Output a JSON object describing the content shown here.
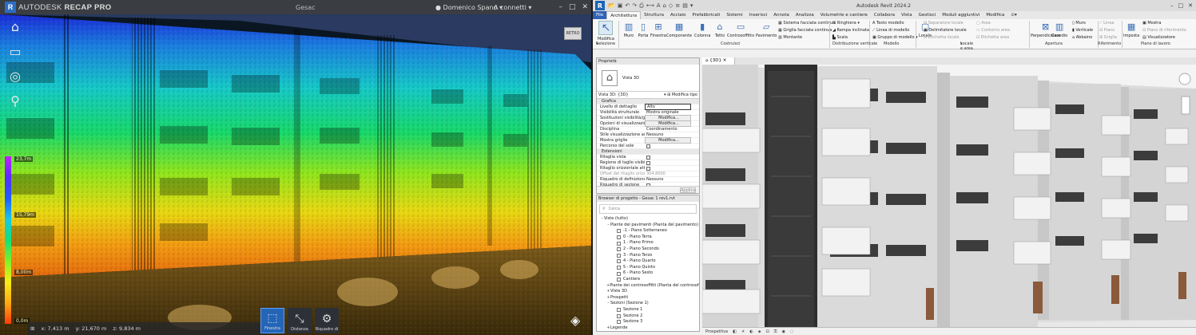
{
  "recap": {
    "logo_letter": "R",
    "brand": "AUTODESK",
    "app": "RECAP PRO",
    "project": "Gesac",
    "user": "Domenico Spano",
    "cloud": "connetti",
    "window": {
      "min": "–",
      "max": "□",
      "close": "✕"
    },
    "legend_labels": [
      "23,7m",
      "15,79m",
      "8,00m",
      "0,0m"
    ],
    "coords": {
      "x": "x: 7,413 m",
      "y": "y: 21,670 m",
      "z": "z: 9,834 m"
    },
    "tools": [
      {
        "label": "Finestra"
      },
      {
        "label": "Distanza"
      },
      {
        "label": "Riquadro di"
      }
    ],
    "view_cube": "RETRO",
    "colors": {
      "bg": "#3a3d42",
      "accent": "#2465b8"
    }
  },
  "revit": {
    "logo_letter": "R",
    "title": "Autodesk Revit 2024.2",
    "window": {
      "min": "–",
      "max": "□",
      "close": "✕"
    },
    "tabs": [
      "File",
      "Architettura",
      "Struttura",
      "Acciaio",
      "Prefabbricati",
      "Sistemi",
      "Inserisci",
      "Annota",
      "Analizza",
      "Volumetrie e cantiere",
      "Collabora",
      "Vista",
      "Gestisci",
      "Moduli aggiuntivi",
      "Modifica"
    ],
    "ribbon_buttons": {
      "modifica": "Modifica",
      "muro": "Muro",
      "porta": "Porta",
      "finestra": "Finestra",
      "componente": "Componente",
      "colonna": "Colonna",
      "tetto": "Tetto",
      "controsoffitto": "Controsoffitto",
      "pavimento": "Pavimento",
      "sistema_facciata": "Sistema facciata continua",
      "griglia_facciata": "Griglia facciata continua",
      "montante": "Montante",
      "ringhiera": "Ringhiera",
      "rampa": "Rampa inclinata",
      "scala": "Scala",
      "testo_modello": "Testo modello",
      "linea_modello": "Linea di modello",
      "gruppo_modello": "Gruppo di modello",
      "locale": "Locale",
      "separatore": "Separatore locale",
      "etichetta_locale": "Etichetta locale",
      "delimitatore": "Delimitatore locale",
      "area": "Area",
      "contorno_area": "Contorno area",
      "etichetta_area": "Etichetta area",
      "perpendicolare": "Perpendicolare",
      "cavedio": "Cavedio",
      "muro2": "Muro",
      "verticale": "Verticale",
      "abbaino": "Abbaino",
      "linea": "Linea",
      "piano": "Piano",
      "griglia": "Griglia",
      "imposta": "Imposta",
      "mostra": "Mostra",
      "piano_riferimento": "Piano di riferimento",
      "visualizzatore": "Visualizzatore"
    },
    "panels": [
      "Selezione",
      "Costruisci",
      "Distribuzione verticale",
      "Modello",
      "Locale e area",
      "Apertura",
      "Riferimento",
      "Piano di lavoro"
    ],
    "properties": {
      "header": "Proprietà",
      "type_name": "Vista 3D",
      "selector": "Vista 3D: {3D}",
      "edit_type": "Modifica tipo",
      "rows": [
        {
          "k": "Grafica",
          "group": true
        },
        {
          "k": "Livello di dettaglio",
          "v": "Alto",
          "kind": "box"
        },
        {
          "k": "Visibilità strutturale",
          "v": "Mostra originale"
        },
        {
          "k": "Sostituzioni visibilità/grafica",
          "v": "Modifica...",
          "kind": "btn"
        },
        {
          "k": "Opzioni di visualizzazione grafica",
          "v": "Modifica...",
          "kind": "btn"
        },
        {
          "k": "Disciplina",
          "v": "Coordinamento"
        },
        {
          "k": "Stile visualizzazione analisi",
          "v": "Nessuno"
        },
        {
          "k": "Mostra griglie",
          "v": "Modifica...",
          "kind": "btn"
        },
        {
          "k": "Percorso del sole",
          "kind": "cb"
        },
        {
          "k": "Estensioni",
          "group": true
        },
        {
          "k": "Ritaglia vista",
          "kind": "cb"
        },
        {
          "k": "Regione di taglio visibile",
          "kind": "cb"
        },
        {
          "k": "Ritaglio orizzontale attivo",
          "kind": "cb"
        },
        {
          "k": "Offset del ritaglio orizzontale",
          "v": "304,8000",
          "dim": true
        },
        {
          "k": "Riquadro di definizione",
          "v": "Nessuno"
        },
        {
          "k": "Riquadro di sezione",
          "kind": "cb"
        }
      ],
      "apply": "Applica"
    },
    "browser": {
      "header": "Browser di progetto - Gesac 1 rev1.rvt",
      "search": "Cerca",
      "nodes": [
        {
          "t": "Viste (tutto)",
          "lvl": 0,
          "tw": "–"
        },
        {
          "t": "Piante dei pavimenti (Pianta del pavimento)",
          "lvl": 1,
          "tw": "–"
        },
        {
          "t": "-1 - Piano Sotterraneo",
          "lvl": 2,
          "vi": true
        },
        {
          "t": "0 - Piano Terra",
          "lvl": 2,
          "vi": true
        },
        {
          "t": "1 - Piano Primo",
          "lvl": 2,
          "vi": true
        },
        {
          "t": "2 - Piano Secondo",
          "lvl": 2,
          "vi": true
        },
        {
          "t": "3 - Piano Terzo",
          "lvl": 2,
          "vi": true
        },
        {
          "t": "4 - Piano Quarto",
          "lvl": 2,
          "vi": true
        },
        {
          "t": "5 - Piano Quinto",
          "lvl": 2,
          "vi": true
        },
        {
          "t": "6 - Piano Sesto",
          "lvl": 2,
          "vi": true
        },
        {
          "t": "Cantiere",
          "lvl": 2,
          "vi": true
        },
        {
          "t": "Piante dei controsoffitti (Pianta del controsoffitto)",
          "lvl": 1,
          "tw": "+"
        },
        {
          "t": "Viste 3D",
          "lvl": 1,
          "tw": "+"
        },
        {
          "t": "Prospetti",
          "lvl": 1,
          "tw": "+"
        },
        {
          "t": "Sezioni (Sezione 1)",
          "lvl": 1,
          "tw": "–"
        },
        {
          "t": "Sezione 1",
          "lvl": 2,
          "vi": true
        },
        {
          "t": "Sezione 2",
          "lvl": 2,
          "vi": true
        },
        {
          "t": "Sezione 3",
          "lvl": 2,
          "vi": true
        },
        {
          "t": "Legende",
          "lvl": 1,
          "tw": "+"
        }
      ]
    },
    "view_tab": "{3D}",
    "view_control": "Prospettiva",
    "colors": {
      "file_tab": "#2f63b7"
    }
  }
}
